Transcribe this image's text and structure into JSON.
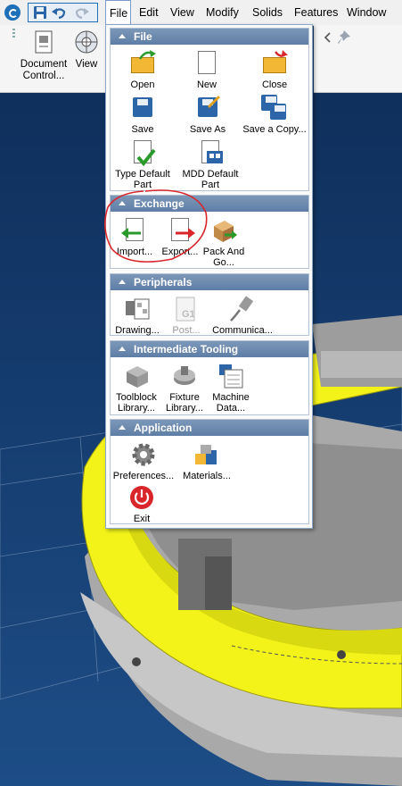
{
  "menubar": {
    "items": [
      "File",
      "Edit",
      "View",
      "Modify",
      "Solids",
      "Features",
      "Window"
    ]
  },
  "ribbon": {
    "document_control_label": "Document Control...",
    "view_label": "View"
  },
  "dropdown": {
    "sections": [
      {
        "title": "File",
        "items": [
          "Open",
          "New",
          "Close",
          "Save",
          "Save As",
          "Save a Copy...",
          "Type Default Part",
          "MDD Default Part"
        ]
      },
      {
        "title": "Exchange",
        "items": [
          "Import...",
          "Export...",
          "Pack And Go..."
        ]
      },
      {
        "title": "Peripherals",
        "items": [
          "Drawing...",
          "Post...",
          "Communica..."
        ]
      },
      {
        "title": "Intermediate Tooling",
        "items": [
          "Toolblock Library...",
          "Fixture Library...",
          "Machine Data..."
        ]
      },
      {
        "title": "Application",
        "items": [
          "Preferences...",
          "Materials...",
          "Exit"
        ]
      }
    ]
  },
  "colors": {
    "accent": "#1d6fb8",
    "section_header": "#6a87ad",
    "annotation": "#d9262b",
    "part_yellow": "#f3f31a",
    "viewport_bg": "#143a6a"
  },
  "icons": [
    "app-logo-icon",
    "save-icon",
    "undo-icon",
    "redo-icon",
    "pin-icon",
    "chevron-left-icon"
  ]
}
